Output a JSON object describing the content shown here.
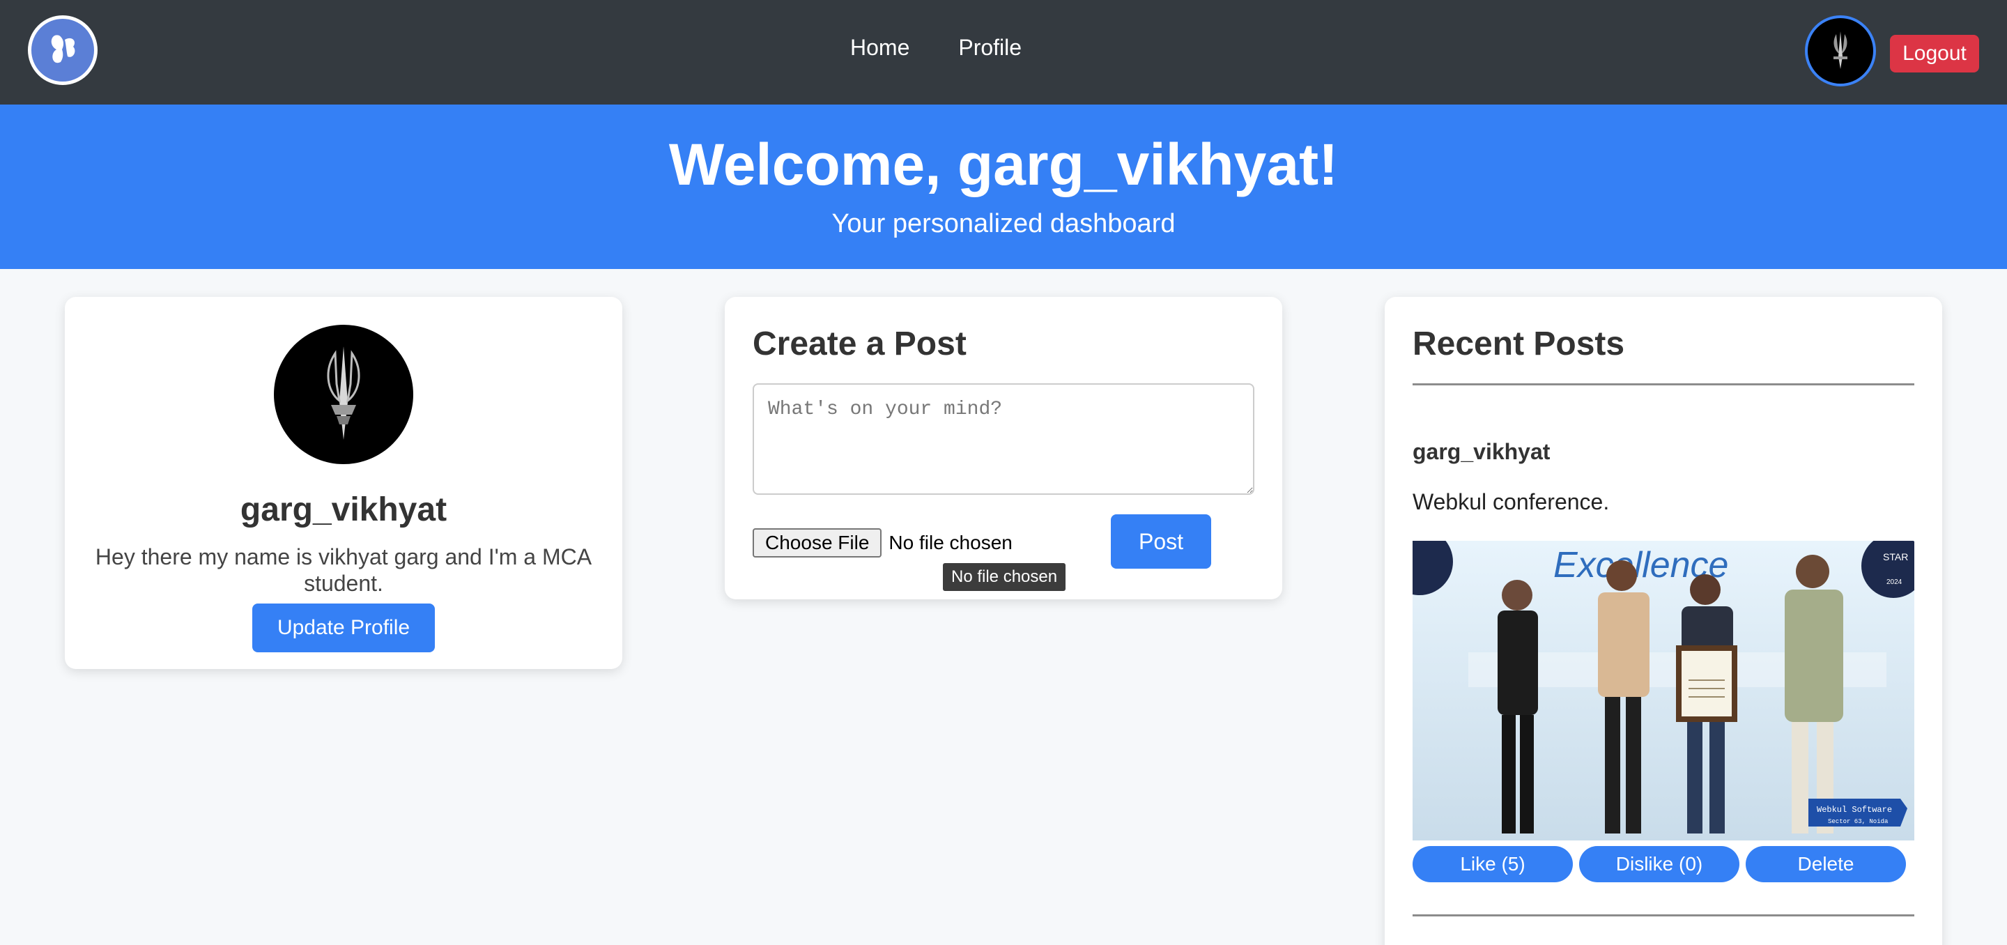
{
  "nav": {
    "links": [
      "Home",
      "Profile"
    ],
    "logout_label": "Logout"
  },
  "hero": {
    "title": "Welcome, garg_vikhyat!",
    "subtitle": "Your personalized dashboard"
  },
  "profile": {
    "username": "garg_vikhyat",
    "bio": "Hey there my name is vikhyat garg and I'm a MCA student.",
    "update_label": "Update Profile"
  },
  "create_post": {
    "heading": "Create a Post",
    "placeholder": "What's on your mind?",
    "choose_file_label": "Choose File",
    "file_status": "No file chosen",
    "tooltip": "No file chosen",
    "post_label": "Post"
  },
  "recent_posts": {
    "heading": "Recent Posts",
    "posts": [
      {
        "author": "garg_vikhyat",
        "text": "Webkul conference.",
        "image_text": {
          "banner": "Excellence",
          "badge_line1": "Webkul Software",
          "badge_line2": "Sector 63, Noida",
          "star_badge": "STAR",
          "star_year": "2024"
        },
        "like_label": "Like (5)",
        "dislike_label": "Dislike (0)",
        "delete_label": "Delete"
      }
    ]
  },
  "colors": {
    "navbar": "#343a40",
    "primary": "#3580f5",
    "danger": "#dc3545",
    "page_bg": "#f6f8fa"
  }
}
